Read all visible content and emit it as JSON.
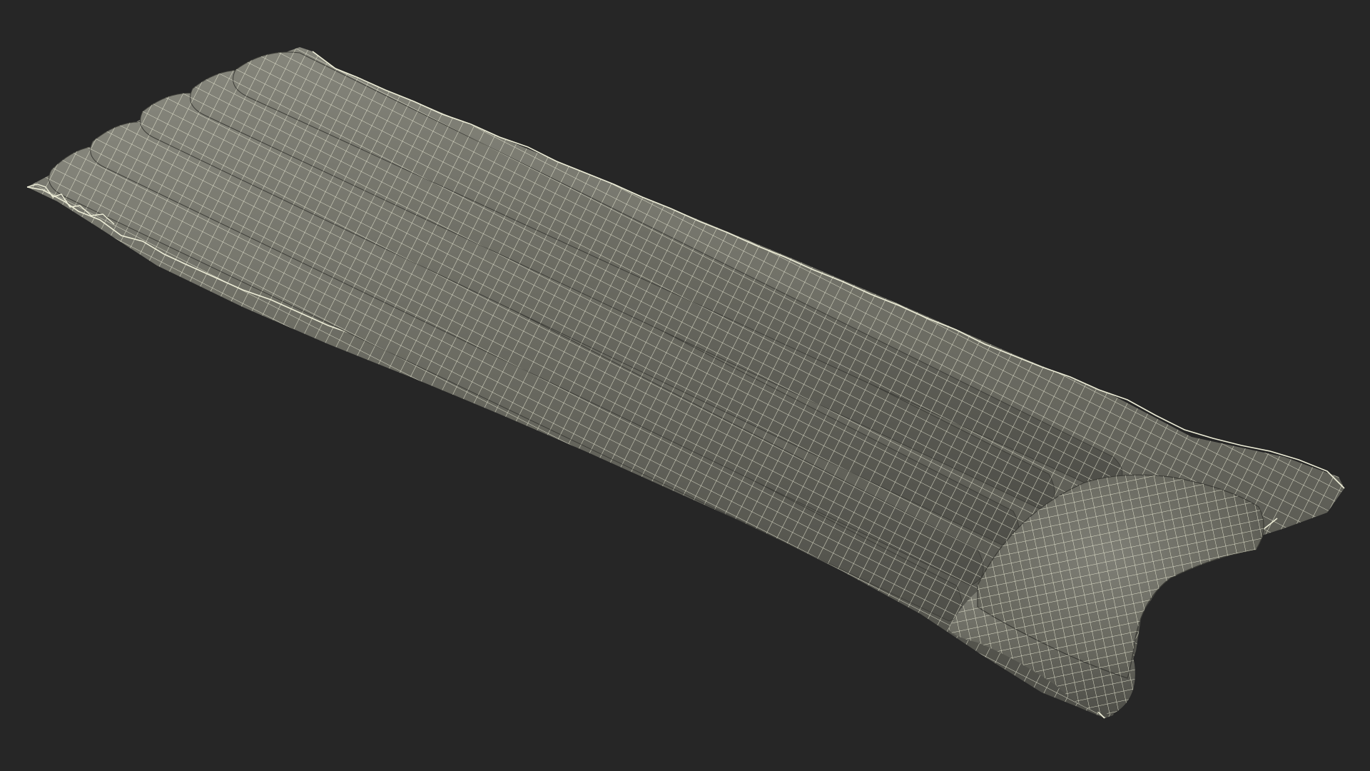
{
  "scene": {
    "subject_icon": "air-mattress-wireframe",
    "colors": {
      "background": "#262626",
      "surface": "#6b6b62",
      "surface_dark": "#4e4e48",
      "surface_light": "#85857b",
      "wire": "#eeeed8"
    },
    "tube_count": 5,
    "has_pillow": true,
    "render_mode": "wireframe"
  }
}
